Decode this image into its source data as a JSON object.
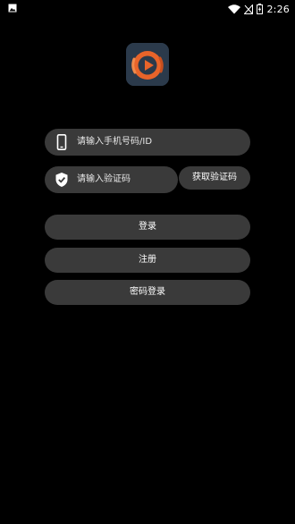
{
  "status_bar": {
    "time": "2:26",
    "icons": [
      "image-notification-icon",
      "wifi-icon",
      "signal-off-icon",
      "battery-charging-icon"
    ]
  },
  "logo": {
    "icon": "play-circle-logo-icon",
    "colors": {
      "background": "#2b3a4b",
      "ring": "#e8642a"
    }
  },
  "login_form": {
    "phone_placeholder": "请输入手机号码/ID",
    "phone_icon": "phone-icon",
    "code_placeholder": "请输入验证码",
    "code_icon": "shield-check-icon",
    "get_code_label": "获取验证码",
    "login_label": "登录",
    "register_label": "注册",
    "password_login_label": "密码登录"
  },
  "colors": {
    "background": "#000000",
    "control": "#3a3a3a",
    "text": "#ffffff"
  }
}
